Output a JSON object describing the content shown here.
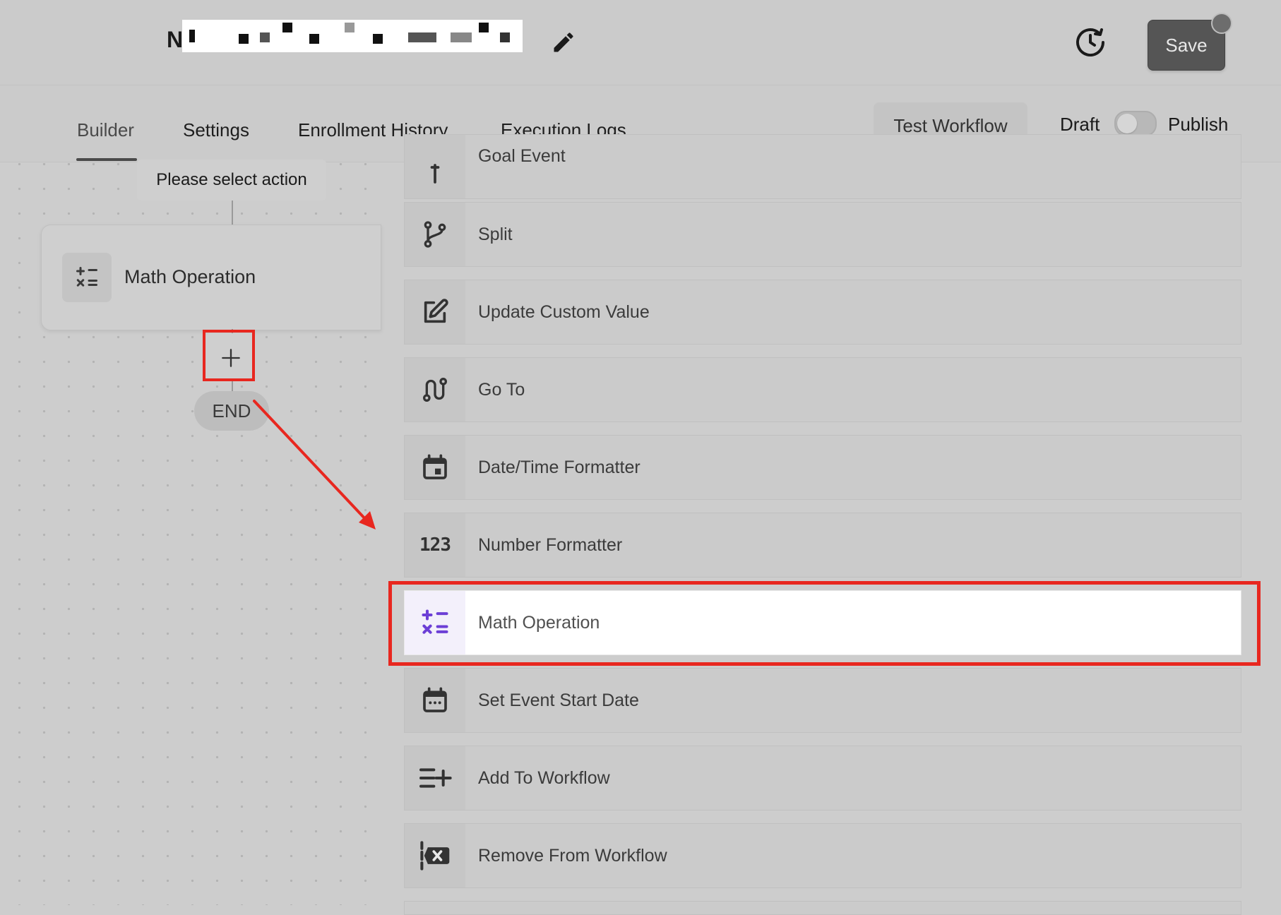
{
  "header": {
    "title_visible": "N",
    "save_label": "Save"
  },
  "tabs": [
    {
      "label": "Builder",
      "active": true
    },
    {
      "label": "Settings",
      "active": false
    },
    {
      "label": "Enrollment History",
      "active": false
    },
    {
      "label": "Execution Logs",
      "active": false
    }
  ],
  "toolbar": {
    "test_label": "Test Workflow",
    "draft_label": "Draft",
    "publish_label": "Publish",
    "published": false
  },
  "canvas": {
    "prompt_text": "Please select action",
    "node_label": "Math Operation",
    "node_icon": "math-operation-icon",
    "end_label": "END"
  },
  "actions": [
    {
      "label": "Goal Event",
      "icon": "goal-event-icon"
    },
    {
      "label": "Split",
      "icon": "split-icon"
    },
    {
      "label": "Update Custom Value",
      "icon": "edit-square-icon"
    },
    {
      "label": "Go To",
      "icon": "go-to-icon"
    },
    {
      "label": "Date/Time Formatter",
      "icon": "calendar-icon"
    },
    {
      "label": "Number Formatter",
      "icon": "number-formatter-icon",
      "glyph": "123"
    },
    {
      "label": "Math Operation",
      "icon": "math-operation-icon",
      "highlighted": true
    },
    {
      "label": "Set Event Start Date",
      "icon": "calendar-dots-icon"
    },
    {
      "label": "Add To Workflow",
      "icon": "list-add-icon"
    },
    {
      "label": "Remove From Workflow",
      "icon": "remove-workflow-icon"
    }
  ],
  "colors": {
    "annotation_red": "#e8271f",
    "accent_purple": "#6c3fd6",
    "overlay_gray": "#cdcdcd"
  }
}
